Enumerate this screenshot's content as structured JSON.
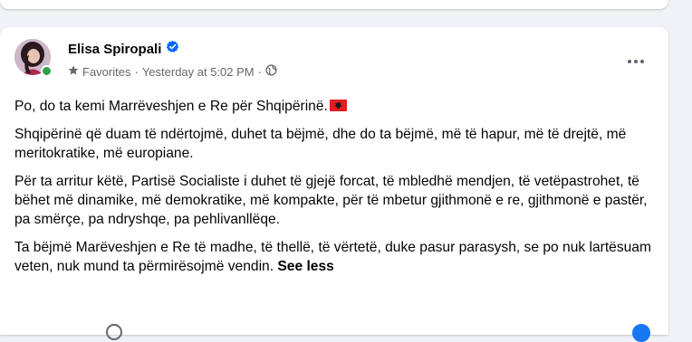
{
  "post": {
    "author": "Elisa Spiropali",
    "audience": "Favorites",
    "separator": "·",
    "time": "Yesterday at 5:02 PM",
    "paragraphs": [
      "Po, do ta kemi Marrëveshjen e Re për Shqipërinë.",
      "Shqipërinë që duam të ndërtojmë, duhet ta bëjmë, dhe do ta bëjmë, më të hapur, më të drejtë, më meritokratike, më europiane.",
      "Për ta arritur këtë, Partisë Socialiste i duhet të gjejë forcat, të mbledhë mendjen, të vetëpastrohet, të bëhet më dinamike, më demokratike, më kompakte, për të mbetur gjithmonë e re, gjithmonë e pastër, pa smërçe, pa ndryshqe, pa pehlivanllëqe.",
      "Ta bëjmë Marëveshjen e Re të madhe, të thellë, të vërtetë, duke pasur parasysh, se po nuk lartësuam veten, nuk mund ta përmirësojmë vendin."
    ],
    "see_less": "See less"
  },
  "icons": {
    "verified": "verified-badge-icon",
    "favorites": "star-icon",
    "privacy": "globe-icon",
    "more": "more-options-icon",
    "flag": "albania-flag-emoji"
  },
  "colors": {
    "background": "#f0f2f5",
    "card": "#ffffff",
    "primary_text": "#050505",
    "secondary_text": "#65676b",
    "verified_blue": "#0866ff",
    "online_green": "#31a24c",
    "flag_red": "#e41e20"
  }
}
